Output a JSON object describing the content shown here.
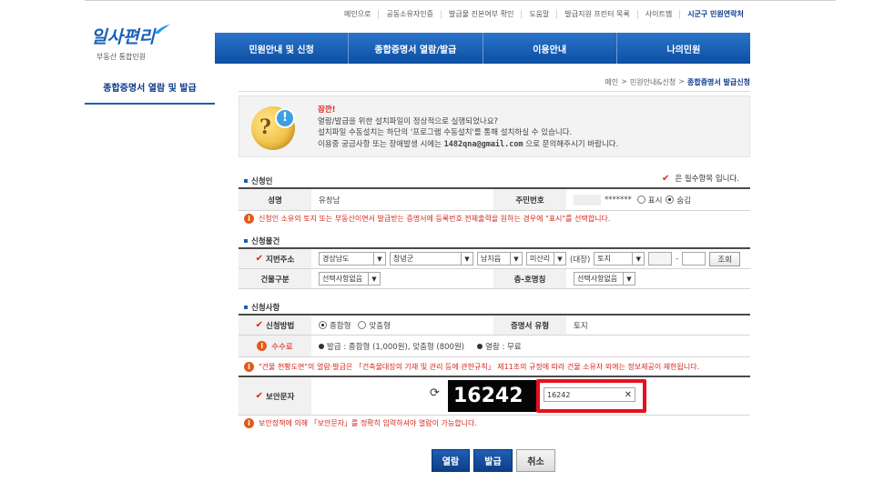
{
  "top_links": [
    "메인으로",
    "공동소유자인증",
    "발급물 진본여부 확인",
    "도움말",
    "발급지원 프린터 목록",
    "사이트맵",
    "시군구 민원연락처"
  ],
  "logo": {
    "main": "일사편리",
    "sub": "부동산 통합민원"
  },
  "nav": [
    "민원안내 및 신청",
    "종합증명서 열람/발급",
    "이용안내",
    "나의민원"
  ],
  "left_title": "종합증명서 열람 및 발급",
  "breadcrumb": {
    "home": "메인",
    "sep": ">",
    "mid": "민원안내&신청",
    "current": "종합증명서 발급신청"
  },
  "notice": {
    "title": "잠깐!",
    "line1": "열람/발급을 위한 설치파일이 정상적으로 실행되었나요?",
    "line2": "설치파일 수동설치는 하단의 '프로그램 수동설치'를 통해 설치하실 수 있습니다.",
    "line3_pre": "이용중 궁금사항 또는 장애발생 시에는",
    "email": "1482qna@gmail.com",
    "line3_post": "으로 문의해주시기 바랍니다."
  },
  "required_note": "은 필수항목 입니다.",
  "applicant": {
    "section": "신청인",
    "name_label": "성명",
    "name_value": "유창남",
    "rrn_label": "주민번호",
    "rrn_masked": "*******",
    "opt_show": "표시",
    "opt_hide": "숨김",
    "warning": "신청인 소유의 토지 또는 부동산이면서 발급받는 증명서에 등록번호 전체출력을 원하는 경우에 \"표시\"를 선택합니다."
  },
  "property": {
    "section": "신청물건",
    "address_label": "지번주소",
    "province": "경상남도",
    "county": "창녕군",
    "town": "남지읍",
    "village": "미산리",
    "daejang_label": "(대장)",
    "land_type": "토지",
    "dash": "-",
    "lookup_btn": "조회",
    "building_label": "건물구분",
    "building_select": "선택사항없음",
    "floor_label": "층-호명칭",
    "floor_select": "선택사항없음"
  },
  "request": {
    "section": "신청사항",
    "method_label": "신청방법",
    "opt_combined": "종합형",
    "opt_custom": "맞춤형",
    "cert_type_label": "증명서 유형",
    "cert_type_value": "토지",
    "fee_label": "수수료",
    "fee_issue": "발급 : 종합형 (1,000원), 맞춤형 (800원)",
    "fee_view": "열람 : 무료",
    "warning": "\"건물 현황도면\"의 열람·발급은 「건축물대장의 기재 및 관리 등에 관한규칙」 제11조의 규정에 따라 건물 소유자 외에는 정보제공이 제한됩니다."
  },
  "captcha": {
    "label": "보안문자",
    "image_text": "16242",
    "input_value": "16242",
    "warning": "보안정책에 의해 「보안문자」를 정확히 입력하셔야 열람이 가능합니다."
  },
  "buttons": {
    "view": "열람",
    "issue": "발급",
    "cancel": "취소"
  }
}
